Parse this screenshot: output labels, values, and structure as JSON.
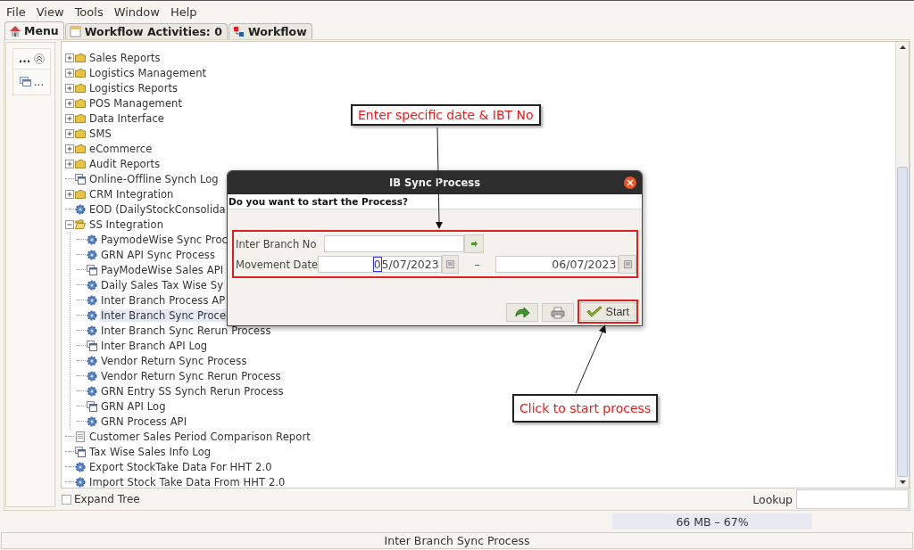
{
  "menu_bar": [
    {
      "label": "File"
    },
    {
      "label": "View"
    },
    {
      "label": "Tools"
    },
    {
      "label": "Window"
    },
    {
      "label": "Help"
    }
  ],
  "tabs": [
    {
      "label": "Menu",
      "selected": true,
      "kind": "home"
    },
    {
      "label": "Workflow Activities: 0",
      "selected": false,
      "kind": "list"
    },
    {
      "label": "Workflow",
      "selected": false,
      "kind": "flow"
    }
  ],
  "side_panel": {
    "items": [
      {
        "label": "...",
        "kind": "header"
      },
      {
        "label": "...",
        "kind": "window"
      }
    ]
  },
  "tree": {
    "items": [
      {
        "label": "Sales Reports",
        "kind": "folder",
        "expanded": false,
        "selected": false
      },
      {
        "label": "Logistics Management",
        "kind": "folder",
        "expanded": false,
        "selected": false
      },
      {
        "label": "Logistics Reports",
        "kind": "folder",
        "expanded": false,
        "selected": false
      },
      {
        "label": "POS Management",
        "kind": "folder",
        "expanded": false,
        "selected": false
      },
      {
        "label": "Data Interface",
        "kind": "folder",
        "expanded": false,
        "selected": false
      },
      {
        "label": "SMS",
        "kind": "folder",
        "expanded": false,
        "selected": false
      },
      {
        "label": "eCommerce",
        "kind": "folder",
        "expanded": false,
        "selected": false
      },
      {
        "label": "Audit Reports",
        "kind": "folder",
        "expanded": false,
        "selected": false
      },
      {
        "label": "Online-Offline Synch Log",
        "kind": "log",
        "selected": false
      },
      {
        "label": "CRM Integration",
        "kind": "folder",
        "expanded": false,
        "selected": false
      },
      {
        "label": "EOD (DailyStockConsolida",
        "kind": "process",
        "selected": false
      },
      {
        "label": "SS Integration",
        "kind": "folder",
        "expanded": true,
        "selected": false,
        "children": [
          {
            "label": "PaymodeWise Sync Proc",
            "kind": "process",
            "selected": false
          },
          {
            "label": "GRN API Sync Process",
            "kind": "process",
            "selected": false
          },
          {
            "label": "PayModeWise Sales API",
            "kind": "log",
            "selected": false
          },
          {
            "label": "Daily Sales Tax Wise Sy",
            "kind": "process",
            "selected": false
          },
          {
            "label": "Inter Branch Process AP",
            "kind": "process",
            "selected": false
          },
          {
            "label": "Inter Branch Sync Proce",
            "kind": "process",
            "selected": true
          },
          {
            "label": "Inter Branch Sync Rerun Process",
            "kind": "process",
            "selected": false
          },
          {
            "label": "Inter Branch API Log",
            "kind": "log",
            "selected": false
          },
          {
            "label": "Vendor Return Sync Process",
            "kind": "process",
            "selected": false
          },
          {
            "label": "Vendor Return Sync Rerun Process",
            "kind": "process",
            "selected": false
          },
          {
            "label": "GRN Entry SS Synch Rerun Process",
            "kind": "process",
            "selected": false
          },
          {
            "label": "GRN API Log",
            "kind": "log",
            "selected": false
          },
          {
            "label": "GRN Process API",
            "kind": "process",
            "selected": false
          }
        ]
      },
      {
        "label": "Customer Sales Period Comparison Report",
        "kind": "report",
        "selected": false
      },
      {
        "label": "Tax Wise Sales Info Log",
        "kind": "log",
        "selected": false
      },
      {
        "label": "Export StockTake Data For HHT 2.0",
        "kind": "process",
        "selected": false
      },
      {
        "label": "Import Stock Take Data From HHT 2.0",
        "kind": "process",
        "selected": false
      }
    ]
  },
  "expand_tree": {
    "label": "Expand Tree",
    "checked": false
  },
  "lookup": {
    "label": "Lookup"
  },
  "memory": {
    "text": "66 MB – 67%"
  },
  "status_bar": {
    "text": "Inter Branch Sync Process"
  },
  "dialog": {
    "title": "IB Sync Process",
    "message": "Do you want to start the Process?",
    "inter_branch_no": {
      "label": "Inter Branch No"
    },
    "movement_date": {
      "label": "Movement Date",
      "from": "05/07/2023",
      "separator": "–",
      "to": "06/07/2023"
    },
    "buttons": [
      {
        "kind": "refresh"
      },
      {
        "kind": "print"
      },
      {
        "kind": "start",
        "label": "Start"
      }
    ]
  },
  "annotations": [
    {
      "text": "Enter specific date & IBT No",
      "kind": "top"
    },
    {
      "text": "Click to start process",
      "kind": "bottom"
    }
  ]
}
